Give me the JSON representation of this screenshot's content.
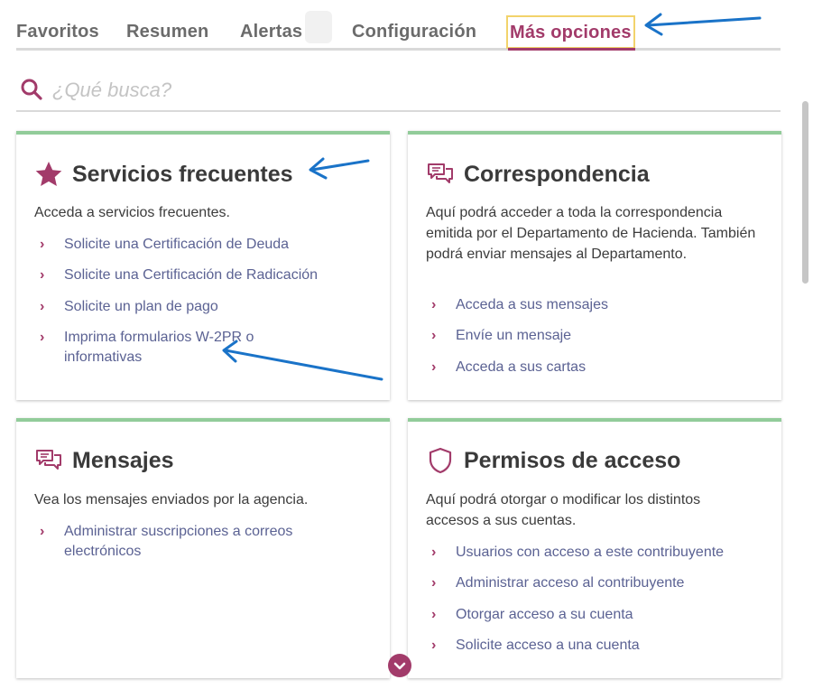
{
  "tabs": [
    {
      "label": "Favoritos"
    },
    {
      "label": "Resumen"
    },
    {
      "label": "Alertas"
    },
    {
      "label": "Configuración"
    },
    {
      "label": "Más opciones",
      "active": true
    }
  ],
  "search": {
    "placeholder": "¿Qué busca?",
    "icon": "search-icon"
  },
  "cards": [
    {
      "title": "Servicios frecuentes",
      "icon": "star-icon",
      "description": "Acceda a servicios frecuentes.",
      "links": [
        "Solicite una Certificación de Deuda",
        "Solicite una Certificación de Radicación",
        "Solicite un plan de pago",
        "Imprima formularios W-2PR o informativas"
      ]
    },
    {
      "title": "Correspondencia",
      "icon": "chat-icon",
      "description": "Aquí podrá acceder a toda la correspondencia emitida por el Departamento de Hacienda. También podrá enviar mensajes al Departamento.",
      "links": [
        "Acceda a sus mensajes",
        "Envíe un mensaje",
        "Acceda a sus cartas"
      ]
    },
    {
      "title": "Mensajes",
      "icon": "chat-icon",
      "description": "Vea los mensajes enviados por la agencia.",
      "links": [
        "Administrar suscripciones a correos electrónicos"
      ]
    },
    {
      "title": "Permisos de acceso",
      "icon": "shield-icon",
      "description": "Aquí podrá otorgar o modificar los distintos accesos a sus cuentas.",
      "links": [
        "Usuarios con acceso a este contribuyente",
        "Administrar acceso al contribuyente",
        "Otorgar acceso a su cuenta",
        "Solicite acceso a una cuenta"
      ]
    }
  ],
  "colors": {
    "accent": "#a23b6a",
    "link": "#5b6293",
    "card_top_border": "#92cc9a",
    "annotation_arrow": "#1a73c8"
  }
}
